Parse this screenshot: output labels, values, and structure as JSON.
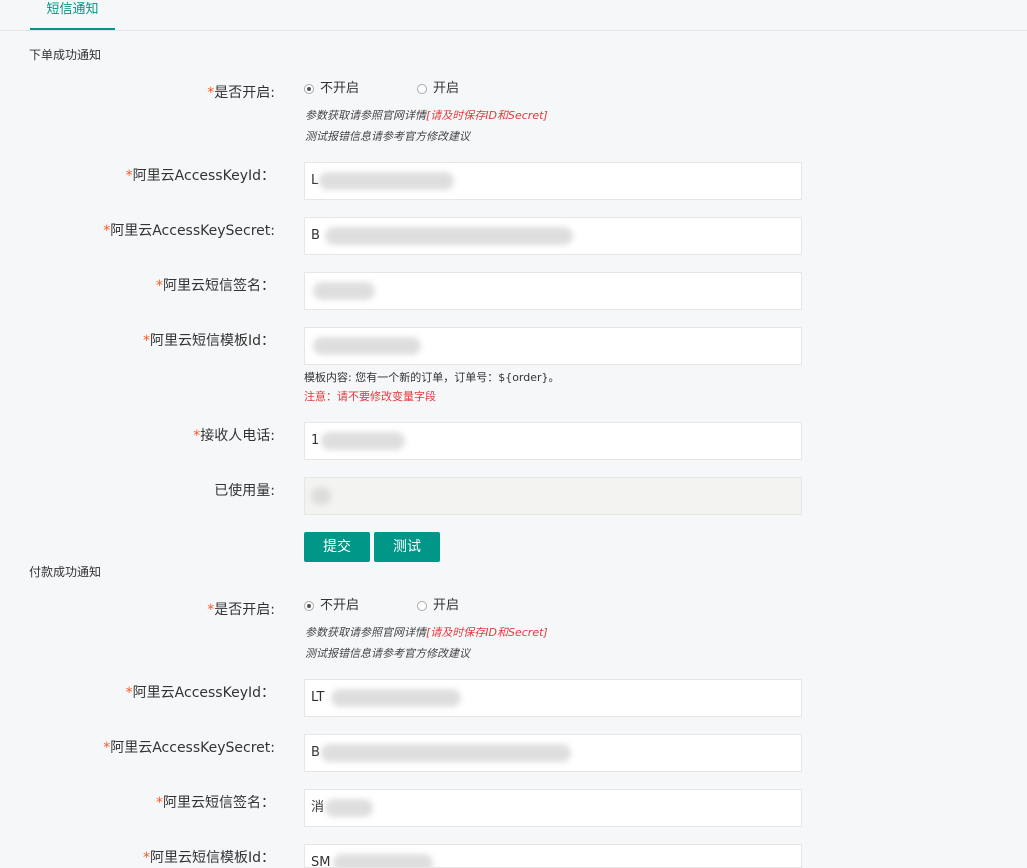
{
  "tabs": [
    {
      "label": "短信通知"
    }
  ],
  "sections": [
    {
      "title": "下单成功通知",
      "enable": {
        "label": "是否开启:",
        "options": [
          "不开启",
          "开启"
        ],
        "selected": 0
      },
      "hint": {
        "text": "参数获取请参照官网详情",
        "warning": "[请及时保存ID和Secret]",
        "line2": "测试报错信息请参考官方修改建议"
      },
      "access_key_id": {
        "label": "阿里云AccessKeyId：",
        "value": "L"
      },
      "access_key_secret": {
        "label": "阿里云AccessKeySecret:",
        "value": "B"
      },
      "sign_name": {
        "label": "阿里云短信签名：",
        "value": ""
      },
      "template_id": {
        "label": "阿里云短信模板Id：",
        "value": ""
      },
      "template_note": "模板内容: 您有一个新的订单，订单号：${order}。",
      "template_warning": "注意：请不要修改变量字段",
      "receiver_phone": {
        "label": "接收人电话:",
        "value": "1"
      },
      "usage": {
        "label": "已使用量:",
        "value": ""
      },
      "submit_label": "提交",
      "test_label": "测试"
    },
    {
      "title": "付款成功通知",
      "enable": {
        "label": "是否开启:",
        "options": [
          "不开启",
          "开启"
        ],
        "selected": 0
      },
      "hint": {
        "text": "参数获取请参照官网详情",
        "warning": "[请及时保存ID和Secret]",
        "line2": "测试报错信息请参考官方修改建议"
      },
      "access_key_id": {
        "label": "阿里云AccessKeyId：",
        "value": "LT"
      },
      "access_key_secret": {
        "label": "阿里云AccessKeySecret:",
        "value": "B"
      },
      "sign_name": {
        "label": "阿里云短信签名：",
        "value": "消"
      },
      "template_id": {
        "label": "阿里云短信模板Id：",
        "value": "SM"
      }
    }
  ],
  "colors": {
    "accent": "#009688",
    "required": "#ff5722",
    "warning": "#e4393c"
  }
}
